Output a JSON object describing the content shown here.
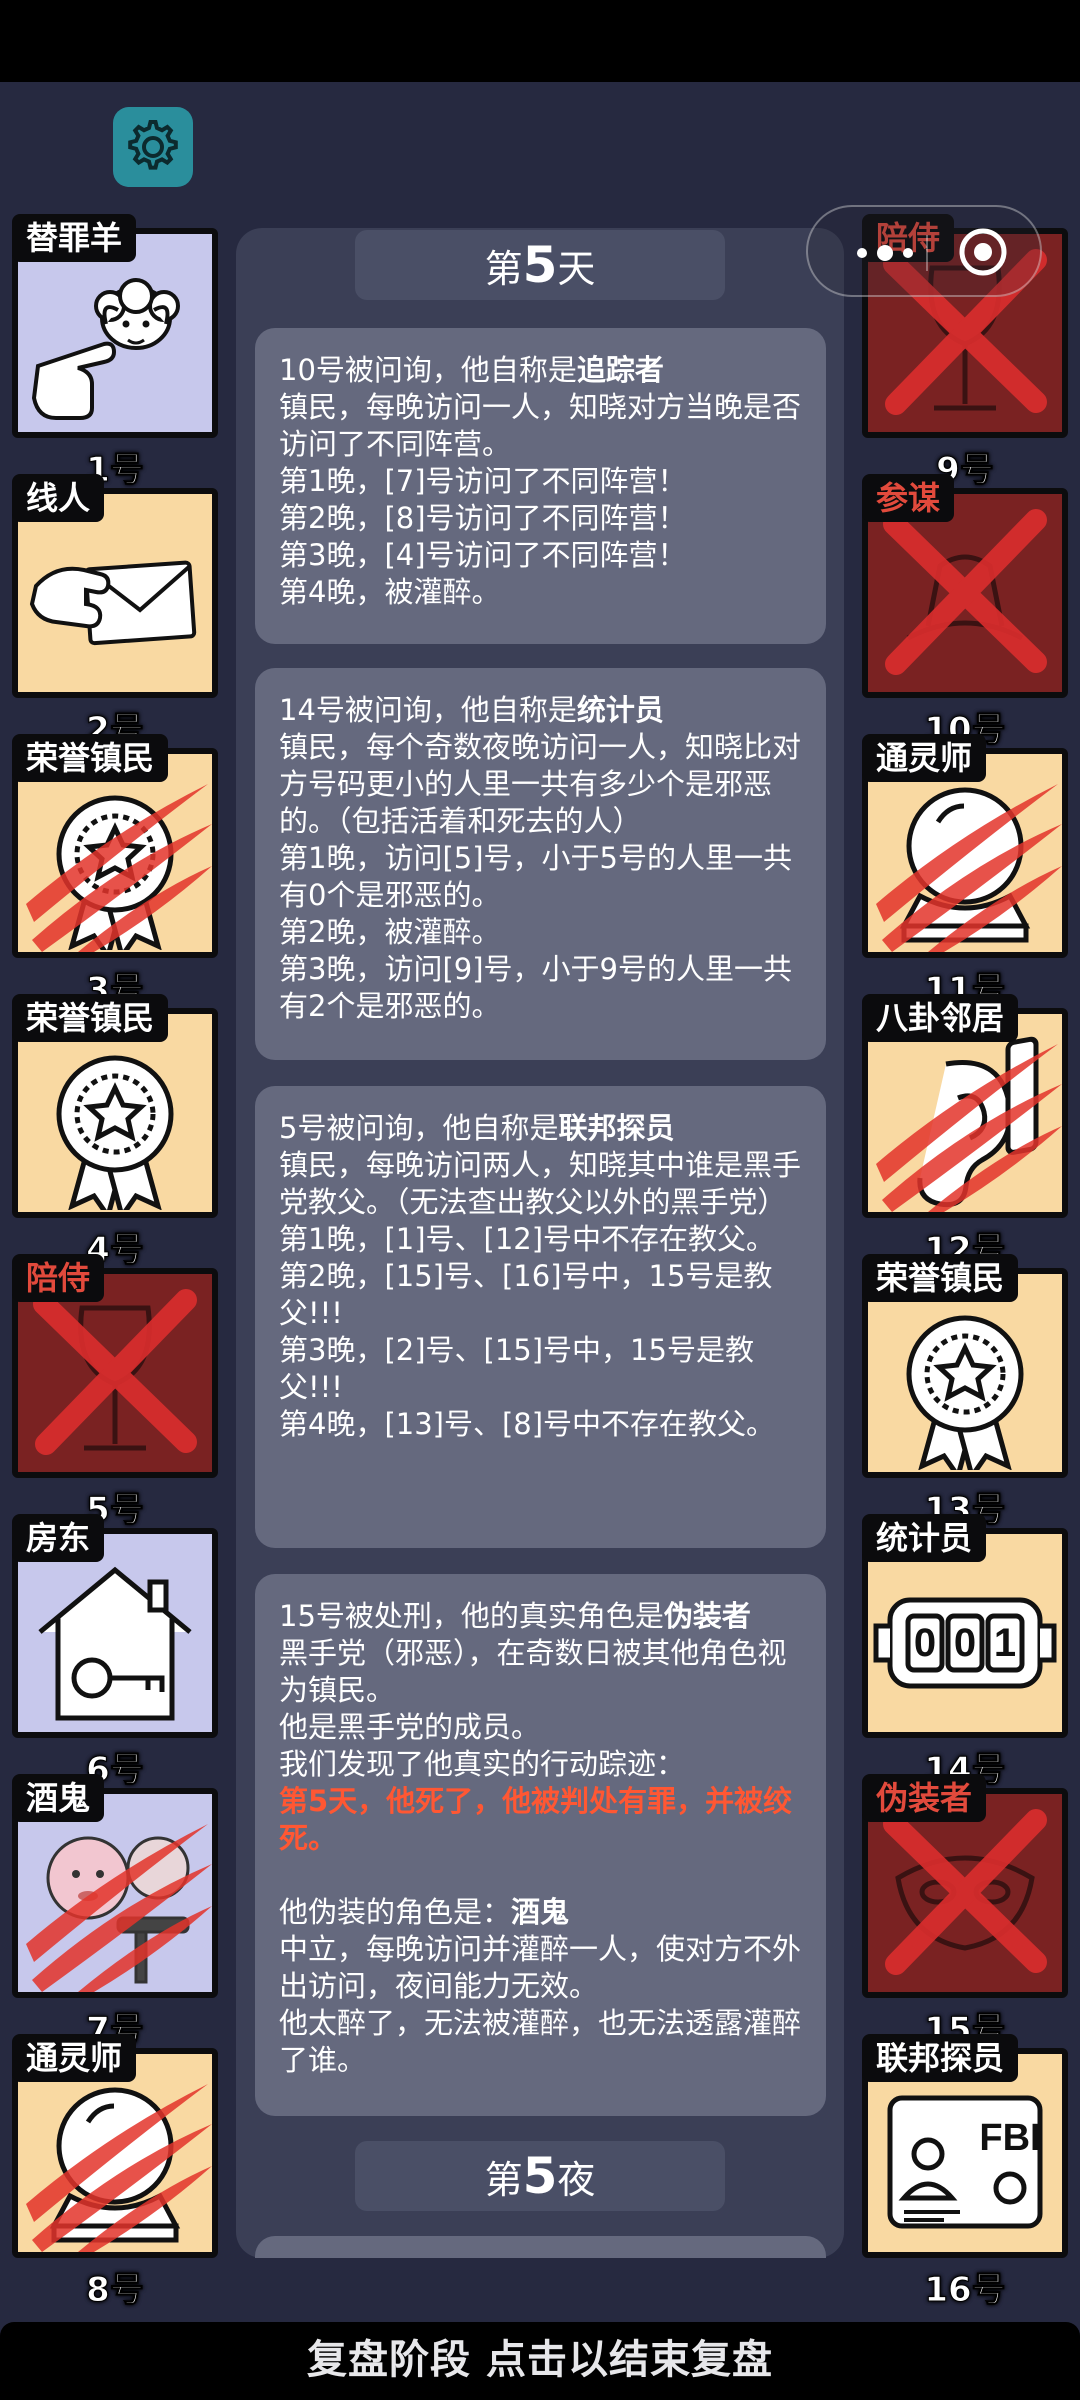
{
  "capsule": {
    "menu_icon": "more-dots-icon",
    "close_icon": "target-circle-icon"
  },
  "settings": {
    "icon": "gear-icon"
  },
  "day_header": {
    "prefix": "第",
    "number": "5",
    "suffix": "天"
  },
  "night_header": {
    "prefix": "第",
    "number": "5",
    "suffix": "夜"
  },
  "left_cards": [
    {
      "role": "替罪羊",
      "num": "1号",
      "icon": "sheep-finger-icon",
      "dead": false,
      "clawed": false,
      "bg": "purple"
    },
    {
      "role": "线人",
      "num": "2号",
      "icon": "envelope-hand-icon",
      "dead": false,
      "clawed": false,
      "bg": "yellow"
    },
    {
      "role": "荣誉镇民",
      "num": "3号",
      "icon": "medal-icon",
      "dead": false,
      "clawed": true,
      "bg": "yellow"
    },
    {
      "role": "荣誉镇民",
      "num": "4号",
      "icon": "medal-icon",
      "dead": false,
      "clawed": false,
      "bg": "yellow"
    },
    {
      "role": "陪侍",
      "num": "5号",
      "icon": "wine-glass-icon",
      "dead": true,
      "clawed": false,
      "bg": "dead"
    },
    {
      "role": "房东",
      "num": "6号",
      "icon": "house-key-icon",
      "dead": false,
      "clawed": false,
      "bg": "purple"
    },
    {
      "role": "酒鬼",
      "num": "7号",
      "icon": "drunk-icon",
      "dead": false,
      "clawed": true,
      "bg": "purple"
    },
    {
      "role": "通灵师",
      "num": "8号",
      "icon": "crystal-ball-icon",
      "dead": false,
      "clawed": true,
      "bg": "yellow"
    }
  ],
  "right_cards": [
    {
      "role": "陪侍",
      "num": "9号",
      "icon": "wine-glass-icon",
      "dead": true,
      "clawed": false,
      "bg": "dead"
    },
    {
      "role": "参谋",
      "num": "10号",
      "icon": "hat-icon",
      "dead": true,
      "clawed": false,
      "bg": "dead"
    },
    {
      "role": "通灵师",
      "num": "11号",
      "icon": "crystal-ball-icon",
      "dead": false,
      "clawed": true,
      "bg": "yellow"
    },
    {
      "role": "八卦邻居",
      "num": "12号",
      "icon": "ear-icon",
      "dead": false,
      "clawed": true,
      "bg": "yellow"
    },
    {
      "role": "荣誉镇民",
      "num": "13号",
      "icon": "medal-icon",
      "dead": false,
      "clawed": false,
      "bg": "yellow"
    },
    {
      "role": "统计员",
      "num": "14号",
      "icon": "counter-icon",
      "dead": false,
      "clawed": false,
      "bg": "yellow",
      "counter": "001"
    },
    {
      "role": "伪装者",
      "num": "15号",
      "icon": "mask-icon",
      "dead": true,
      "clawed": false,
      "bg": "dead"
    },
    {
      "role": "联邦探员",
      "num": "16号",
      "icon": "fbi-badge-icon",
      "dead": false,
      "clawed": false,
      "bg": "yellow",
      "badge_text": "FBI"
    }
  ],
  "messages": [
    [
      {
        "t": "10号被问询，他自称是"
      },
      {
        "b": "追踪者"
      },
      {
        "br": 1
      },
      {
        "t": "镇民，每晚访问一人，知晓对方当晚是否访问了不同阵营。"
      },
      {
        "br": 1
      },
      {
        "t": "第1晚，[7]号访问了不同阵营！"
      },
      {
        "br": 1
      },
      {
        "t": "第2晚，[8]号访问了不同阵营！"
      },
      {
        "br": 1
      },
      {
        "t": "第3晚，[4]号访问了不同阵营！"
      },
      {
        "br": 1
      },
      {
        "t": "第4晚，被灌醉。"
      }
    ],
    [
      {
        "t": "14号被问询，他自称是"
      },
      {
        "b": "统计员"
      },
      {
        "br": 1
      },
      {
        "t": "镇民，每个奇数夜晚访问一人，知晓比对方号码更小的人里一共有多少个是邪恶的。（包括活着和死去的人）"
      },
      {
        "br": 1
      },
      {
        "t": "第1晚，访问[5]号，小于5号的人里一共有0个是邪恶的。"
      },
      {
        "br": 1
      },
      {
        "t": "第2晚，被灌醉。"
      },
      {
        "br": 1
      },
      {
        "t": "第3晚，访问[9]号，小于9号的人里一共有2个是邪恶的。"
      }
    ],
    [
      {
        "t": "5号被问询，他自称是"
      },
      {
        "b": "联邦探员"
      },
      {
        "br": 1
      },
      {
        "t": "镇民，每晚访问两人，知晓其中谁是黑手党教父。（无法查出教父以外的黑手党）"
      },
      {
        "br": 1
      },
      {
        "t": "第1晚，[1]号、[12]号中不存在教父。"
      },
      {
        "br": 1
      },
      {
        "t": "第2晚，[15]号、[16]号中，15号是教父!!!"
      },
      {
        "br": 1
      },
      {
        "t": "第3晚，[2]号、[15]号中，15号是教父!!!"
      },
      {
        "br": 1
      },
      {
        "t": "第4晚，[13]号、[8]号中不存在教父。"
      }
    ],
    [
      {
        "t": "15号被处刑，他的真实角色是"
      },
      {
        "b": "伪装者"
      },
      {
        "br": 1
      },
      {
        "t": "黑手党（邪恶），在奇数日被其他角色视为镇民。"
      },
      {
        "br": 1
      },
      {
        "t": "他是黑手党的成员。"
      },
      {
        "br": 1
      },
      {
        "t": "我们发现了他真实的行动踪迹："
      },
      {
        "br": 1
      },
      {
        "hl": "第5天，他死了，他被判处有罪，并被绞死。"
      },
      {
        "br": 1
      },
      {
        "br": 1
      },
      {
        "t": "他伪装的角色是："
      },
      {
        "b": "酒鬼"
      },
      {
        "br": 1
      },
      {
        "t": "中立，每晚访问并灌醉一人，使对方不外出访问，夜间能力无效。"
      },
      {
        "br": 1
      },
      {
        "t": "他太醉了，无法被灌醉，也无法透露灌醉了谁。"
      }
    ]
  ],
  "bottom_bar": {
    "label": "复盘阶段 点击以结束复盘"
  }
}
